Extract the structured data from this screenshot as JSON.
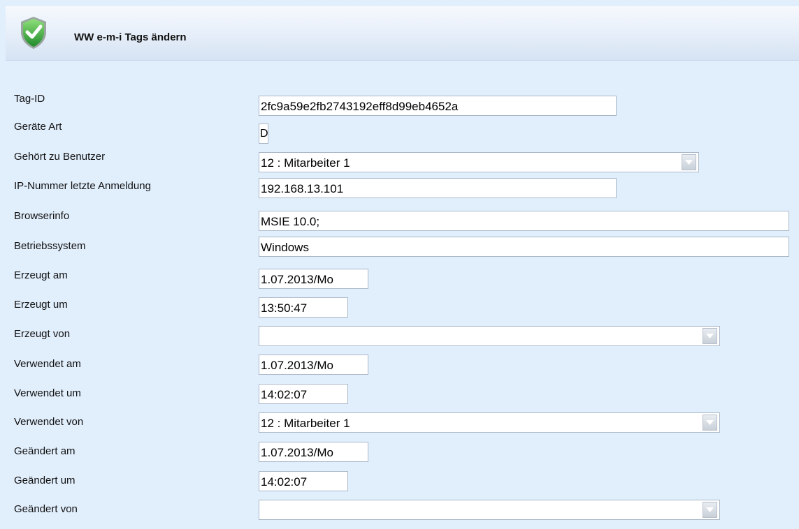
{
  "header": {
    "title": "WW e-m-i Tags ändern",
    "icon": "shield-check-icon"
  },
  "form": {
    "tag_id": {
      "label": "Tag-ID",
      "value": "2fc9a59e2fb2743192eff8d99eb4652a"
    },
    "geraete_art": {
      "label": "Geräte Art",
      "value": "D"
    },
    "gehoert_zu_benutzer": {
      "label": "Gehört zu Benutzer",
      "value": "12 : Mitarbeiter 1"
    },
    "ip_nummer": {
      "label": "IP-Nummer letzte Anmeldung",
      "value": "192.168.13.101"
    },
    "browserinfo": {
      "label": "Browserinfo",
      "value": "MSIE 10.0;"
    },
    "betriebssystem": {
      "label": "Betriebssystem",
      "value": "Windows"
    },
    "erzeugt_am": {
      "label": "Erzeugt am",
      "value": "1.07.2013/Mo"
    },
    "erzeugt_um": {
      "label": "Erzeugt um",
      "value": "13:50:47"
    },
    "erzeugt_von": {
      "label": "Erzeugt von",
      "value": ""
    },
    "verwendet_am": {
      "label": "Verwendet am",
      "value": "1.07.2013/Mo"
    },
    "verwendet_um": {
      "label": "Verwendet um",
      "value": "14:02:07"
    },
    "verwendet_von": {
      "label": "Verwendet von",
      "value": "12 : Mitarbeiter 1"
    },
    "geaendert_am": {
      "label": "Geändert am",
      "value": "1.07.2013/Mo"
    },
    "geaendert_um": {
      "label": "Geändert um",
      "value": "14:02:07"
    },
    "geaendert_von": {
      "label": "Geändert von",
      "value": ""
    }
  }
}
